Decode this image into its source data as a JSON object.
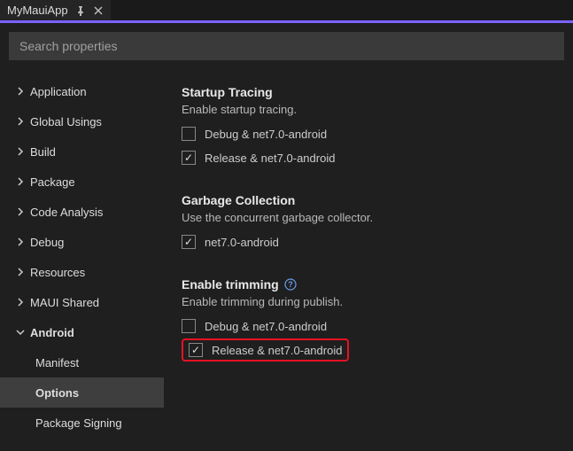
{
  "tab": {
    "title": "MyMauiApp"
  },
  "search": {
    "placeholder": "Search properties"
  },
  "sidebar": {
    "items": [
      {
        "label": "Application",
        "expanded": false,
        "depth": 0
      },
      {
        "label": "Global Usings",
        "expanded": false,
        "depth": 0
      },
      {
        "label": "Build",
        "expanded": false,
        "depth": 0
      },
      {
        "label": "Package",
        "expanded": false,
        "depth": 0
      },
      {
        "label": "Code Analysis",
        "expanded": false,
        "depth": 0
      },
      {
        "label": "Debug",
        "expanded": false,
        "depth": 0
      },
      {
        "label": "Resources",
        "expanded": false,
        "depth": 0
      },
      {
        "label": "MAUI Shared",
        "expanded": false,
        "depth": 0
      },
      {
        "label": "Android",
        "expanded": true,
        "depth": 0,
        "bold": true
      },
      {
        "label": "Manifest",
        "depth": 1
      },
      {
        "label": "Options",
        "depth": 1,
        "selected": true,
        "bold": true
      },
      {
        "label": "Package Signing",
        "depth": 1
      }
    ]
  },
  "sections": {
    "startup_tracing": {
      "title": "Startup Tracing",
      "desc": "Enable startup tracing.",
      "opts": [
        {
          "label": "Debug & net7.0-android",
          "checked": false
        },
        {
          "label": "Release & net7.0-android",
          "checked": true
        }
      ]
    },
    "gc": {
      "title": "Garbage Collection",
      "desc": "Use the concurrent garbage collector.",
      "opts": [
        {
          "label": "net7.0-android",
          "checked": true
        }
      ]
    },
    "trimming": {
      "title": "Enable trimming",
      "desc": "Enable trimming during publish.",
      "opts": [
        {
          "label": "Debug & net7.0-android",
          "checked": false
        },
        {
          "label": "Release & net7.0-android",
          "checked": true,
          "highlight": true
        }
      ]
    }
  }
}
